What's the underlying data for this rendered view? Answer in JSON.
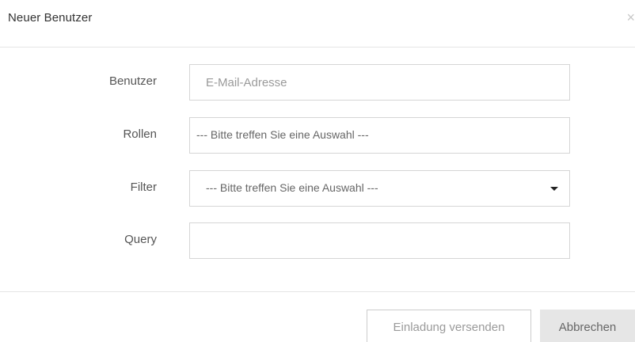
{
  "modal": {
    "title": "Neuer Benutzer",
    "close_icon": "close-icon",
    "close_glyph": "×"
  },
  "form": {
    "user": {
      "label": "Benutzer",
      "placeholder": "E-Mail-Adresse",
      "value": ""
    },
    "roles": {
      "label": "Rollen",
      "selected": "--- Bitte treffen Sie eine Auswahl ---"
    },
    "filter": {
      "label": "Filter",
      "selected": "--- Bitte treffen Sie eine Auswahl ---",
      "icon": "caret-down-icon"
    },
    "query": {
      "label": "Query",
      "value": ""
    }
  },
  "footer": {
    "invite_label": "Einladung versenden",
    "cancel_label": "Abbrechen"
  },
  "colors": {
    "border": "#d5d5d5",
    "divider": "#e5e5e5",
    "cancel_bg": "#e6e6e6",
    "text": "#333333",
    "muted": "#9a9a9a"
  }
}
